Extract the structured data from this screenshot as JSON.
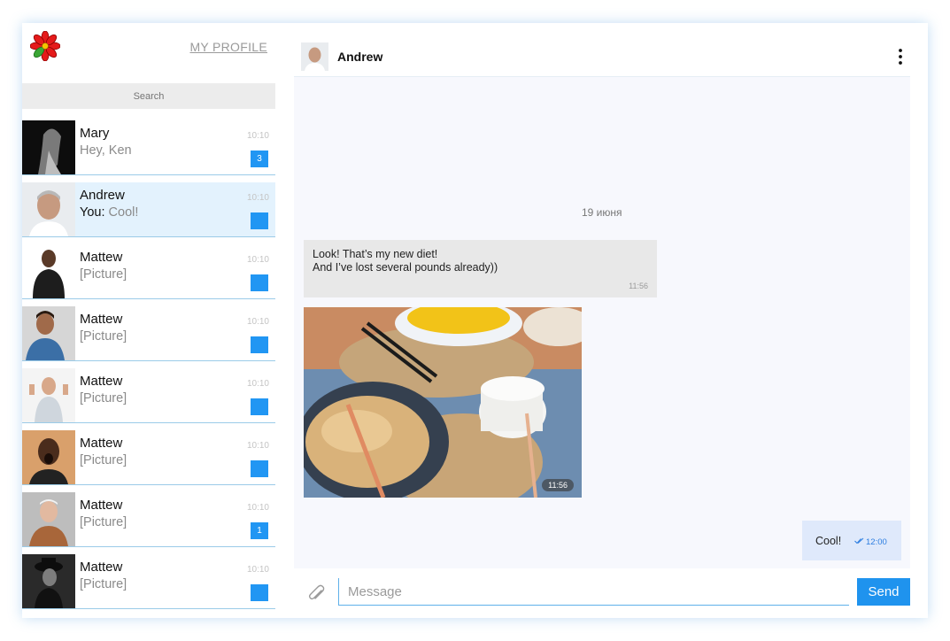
{
  "sidebar": {
    "profile_link": "MY PROFILE",
    "search_label": "Search",
    "chats": [
      {
        "name": "Mary",
        "preview": "Hey, Ken",
        "you_prefix": "",
        "time": "10:10",
        "badge": "3"
      },
      {
        "name": "Andrew",
        "preview": "Cool!",
        "you_prefix": "You:",
        "time": "10:10",
        "badge": ""
      },
      {
        "name": "Mattew",
        "preview": "[Picture]",
        "you_prefix": "",
        "time": "10:10",
        "badge": ""
      },
      {
        "name": "Mattew",
        "preview": "[Picture]",
        "you_prefix": "",
        "time": "10:10",
        "badge": ""
      },
      {
        "name": "Mattew",
        "preview": "[Picture]",
        "you_prefix": "",
        "time": "10:10",
        "badge": ""
      },
      {
        "name": "Mattew",
        "preview": "[Picture]",
        "you_prefix": "",
        "time": "10:10",
        "badge": ""
      },
      {
        "name": "Mattew",
        "preview": "[Picture]",
        "you_prefix": "",
        "time": "10:10",
        "badge": "1"
      },
      {
        "name": "Mattew",
        "preview": "[Picture]",
        "you_prefix": "",
        "time": "10:10",
        "badge": ""
      }
    ]
  },
  "header": {
    "contact_name": "Andrew"
  },
  "conversation": {
    "date": "19 июня",
    "incoming": {
      "line1": "Look! That’s my new diet!",
      "line2": "And I’ve lost several pounds already))",
      "time": "11:56"
    },
    "photo": {
      "time": "11:56"
    },
    "outgoing": {
      "text": "Cool!",
      "time": "12:00"
    }
  },
  "composer": {
    "placeholder": "Message",
    "send_label": "Send"
  },
  "colors": {
    "accent": "#1f93ee",
    "active_chat": "#e3f2fd",
    "badge": "#2196f3",
    "incoming_bubble": "#e8e8e8",
    "outgoing_bubble": "#dfe9fb",
    "logo_red": "#e51a1a"
  },
  "icons": [
    "flower-logo-icon",
    "more-vertical-icon",
    "paperclip-icon",
    "double-check-icon"
  ]
}
